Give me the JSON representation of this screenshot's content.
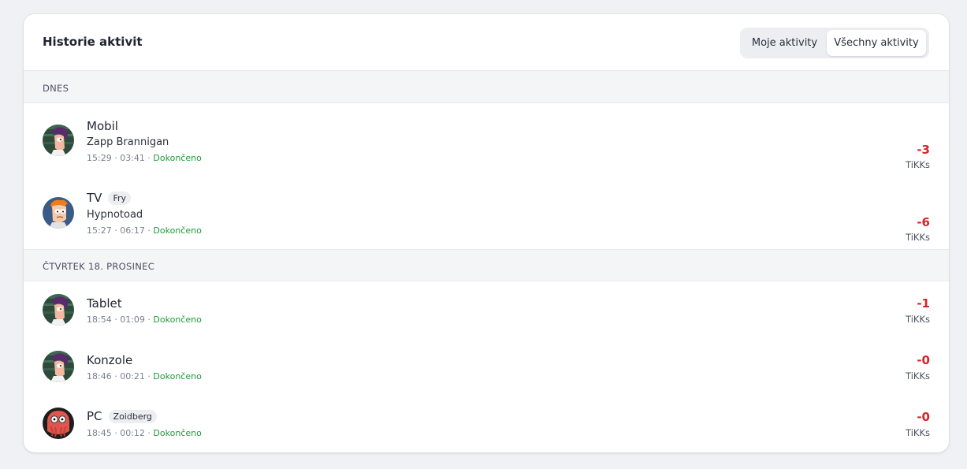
{
  "header": {
    "title": "Historie aktivit",
    "tabs": [
      {
        "label": "Moje aktivity",
        "active": false
      },
      {
        "label": "Všechny aktivity",
        "active": true
      }
    ]
  },
  "colors": {
    "negative_amount": "#d8232a",
    "status_done": "#1e9a3a"
  },
  "groups": [
    {
      "label": "DNES",
      "items": [
        {
          "device": "Mobil",
          "user_chip": "",
          "subtitle": "Zapp Brannigan",
          "time": "15:29",
          "duration": "03:41",
          "status": "Dokončeno",
          "amount": "-3",
          "unit": "TiKKs",
          "avatar": "leela-avatar"
        },
        {
          "device": "TV",
          "user_chip": "Fry",
          "subtitle": "Hypnotoad",
          "time": "15:27",
          "duration": "06:17",
          "status": "Dokončeno",
          "amount": "-6",
          "unit": "TiKKs",
          "avatar": "fry-avatar"
        }
      ]
    },
    {
      "label": "ČTVRTEK 18. PROSINEC",
      "items": [
        {
          "device": "Tablet",
          "user_chip": "",
          "subtitle": "",
          "time": "18:54",
          "duration": "01:09",
          "status": "Dokončeno",
          "amount": "-1",
          "unit": "TiKKs",
          "avatar": "leela-avatar"
        },
        {
          "device": "Konzole",
          "user_chip": "",
          "subtitle": "",
          "time": "18:46",
          "duration": "00:21",
          "status": "Dokončeno",
          "amount": "-0",
          "unit": "TiKKs",
          "avatar": "leela-avatar"
        },
        {
          "device": "PC",
          "user_chip": "Zoidberg",
          "subtitle": "",
          "time": "18:45",
          "duration": "00:12",
          "status": "Dokončeno",
          "amount": "-0",
          "unit": "TiKKs",
          "avatar": "zoidberg-avatar"
        }
      ]
    }
  ]
}
